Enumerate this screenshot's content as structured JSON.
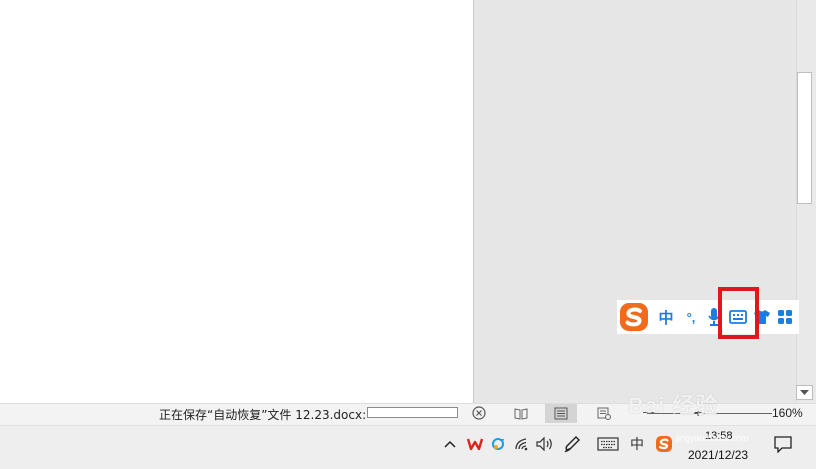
{
  "status_bar": {
    "save_message": "正在保存“自动恢复”文件 12.23.docx:",
    "zoom_level": "160%",
    "zoom_minus": "—",
    "zoom_plus": "+"
  },
  "ime_toolbar": {
    "language": "中",
    "punctuation": "°,"
  },
  "taskbar": {
    "time": "13:58",
    "date": "2021/12/23",
    "ime_tray_label": "中"
  },
  "watermark": {
    "brand": "Bai 经验",
    "url": "jingyan.baidu.com"
  },
  "colors": {
    "highlight_box": "#e3161b",
    "ime_blue": "#1b7de3",
    "sogou_orange": "#f26b1d"
  }
}
